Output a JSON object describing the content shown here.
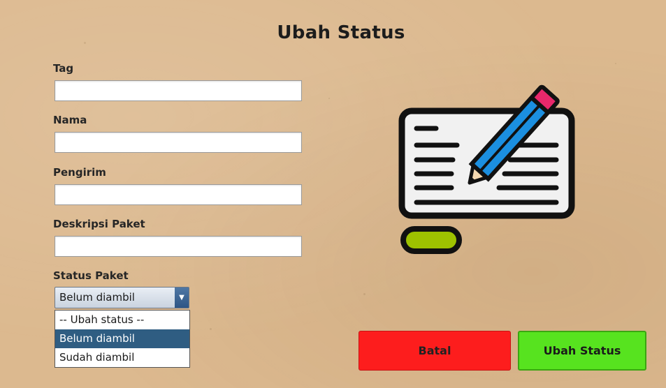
{
  "title": "Ubah Status",
  "form": {
    "tag_label": "Tag",
    "tag_value": "",
    "nama_label": "Nama",
    "nama_value": "",
    "pengirim_label": "Pengirim",
    "pengirim_value": "",
    "deskripsi_label": "Deskripsi Paket",
    "deskripsi_value": "",
    "status_label": "Status Paket",
    "status_selected": "Belum diambil",
    "status_options": [
      "-- Ubah status --",
      "Belum diambil",
      "Sudah diambil"
    ]
  },
  "buttons": {
    "cancel": "Batal",
    "submit": "Ubah Status"
  },
  "colors": {
    "background": "#dcb98f",
    "cancel_button": "#fd1d1d",
    "submit_button": "#57e31f",
    "dropdown_highlight": "#2f5d82",
    "pencil": "#1b8fe0",
    "pencil_eraser": "#e8286b",
    "monitor_base": "#9ec200"
  },
  "illustration": {
    "icon": "edit-document-pencil-icon"
  }
}
